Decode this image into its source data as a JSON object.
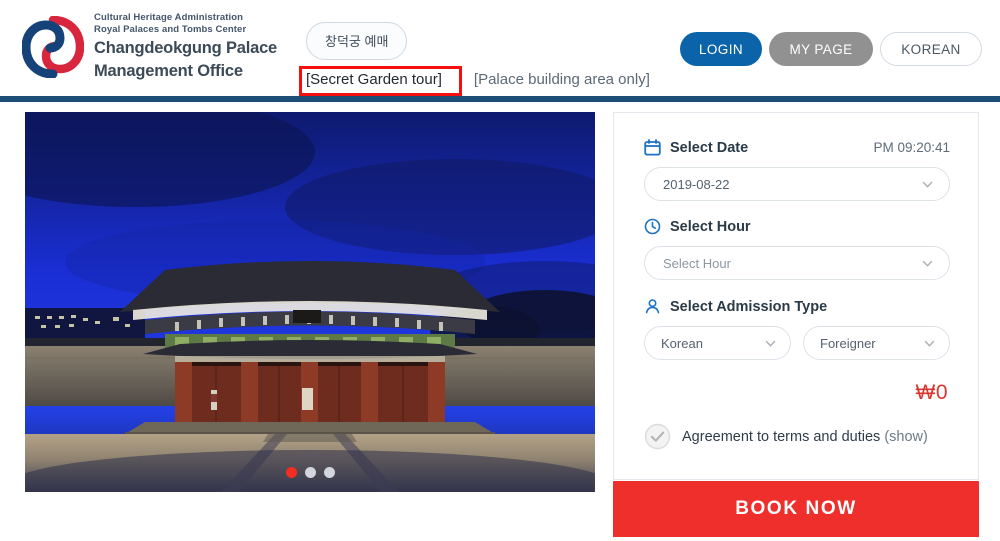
{
  "header": {
    "org_line1": "Cultural Heritage Administration",
    "org_line2": "Royal Palaces and Tombs Center",
    "org_title_line1": "Changdeokgung Palace",
    "org_title_line2": "Management Office",
    "logo_icon": "taegeuk-swirl-logo",
    "korean_pill_label": "창덕궁 예매",
    "buttons": {
      "login": "LOGIN",
      "mypage": "MY PAGE",
      "korean": "KOREAN"
    },
    "colors": {
      "login_bg": "#0b64aa",
      "mypage_bg": "#919191",
      "rule": "#1d4e77",
      "highlight": "#f60f0f"
    }
  },
  "tabs": [
    {
      "label": "[Secret Garden tour]",
      "active": true
    },
    {
      "label": "[Palace building area only]",
      "active": false
    }
  ],
  "hero": {
    "alt": "Changdeokgung palace gate at twilight",
    "dots": [
      {
        "active": true
      },
      {
        "active": false
      },
      {
        "active": false
      }
    ],
    "active_dot_color": "#f22e23"
  },
  "booking": {
    "date": {
      "icon": "calendar-icon",
      "label": "Select Date",
      "clock": "PM 09:20:41",
      "value": "2019-08-22"
    },
    "hour": {
      "icon": "clock-icon",
      "label": "Select Hour",
      "placeholder": "Select Hour"
    },
    "admission": {
      "icon": "person-icon",
      "label": "Select Admission Type",
      "nationality": "Korean",
      "residency": "Foreigner"
    },
    "price": "₩0",
    "price_color": "#d6372f",
    "agreement": {
      "icon": "check-circle-icon",
      "checked": false,
      "text": "Agreement to terms and duties",
      "show_link": "(show)"
    },
    "book_button": "BOOK NOW",
    "book_button_color": "#ee2f2c"
  }
}
